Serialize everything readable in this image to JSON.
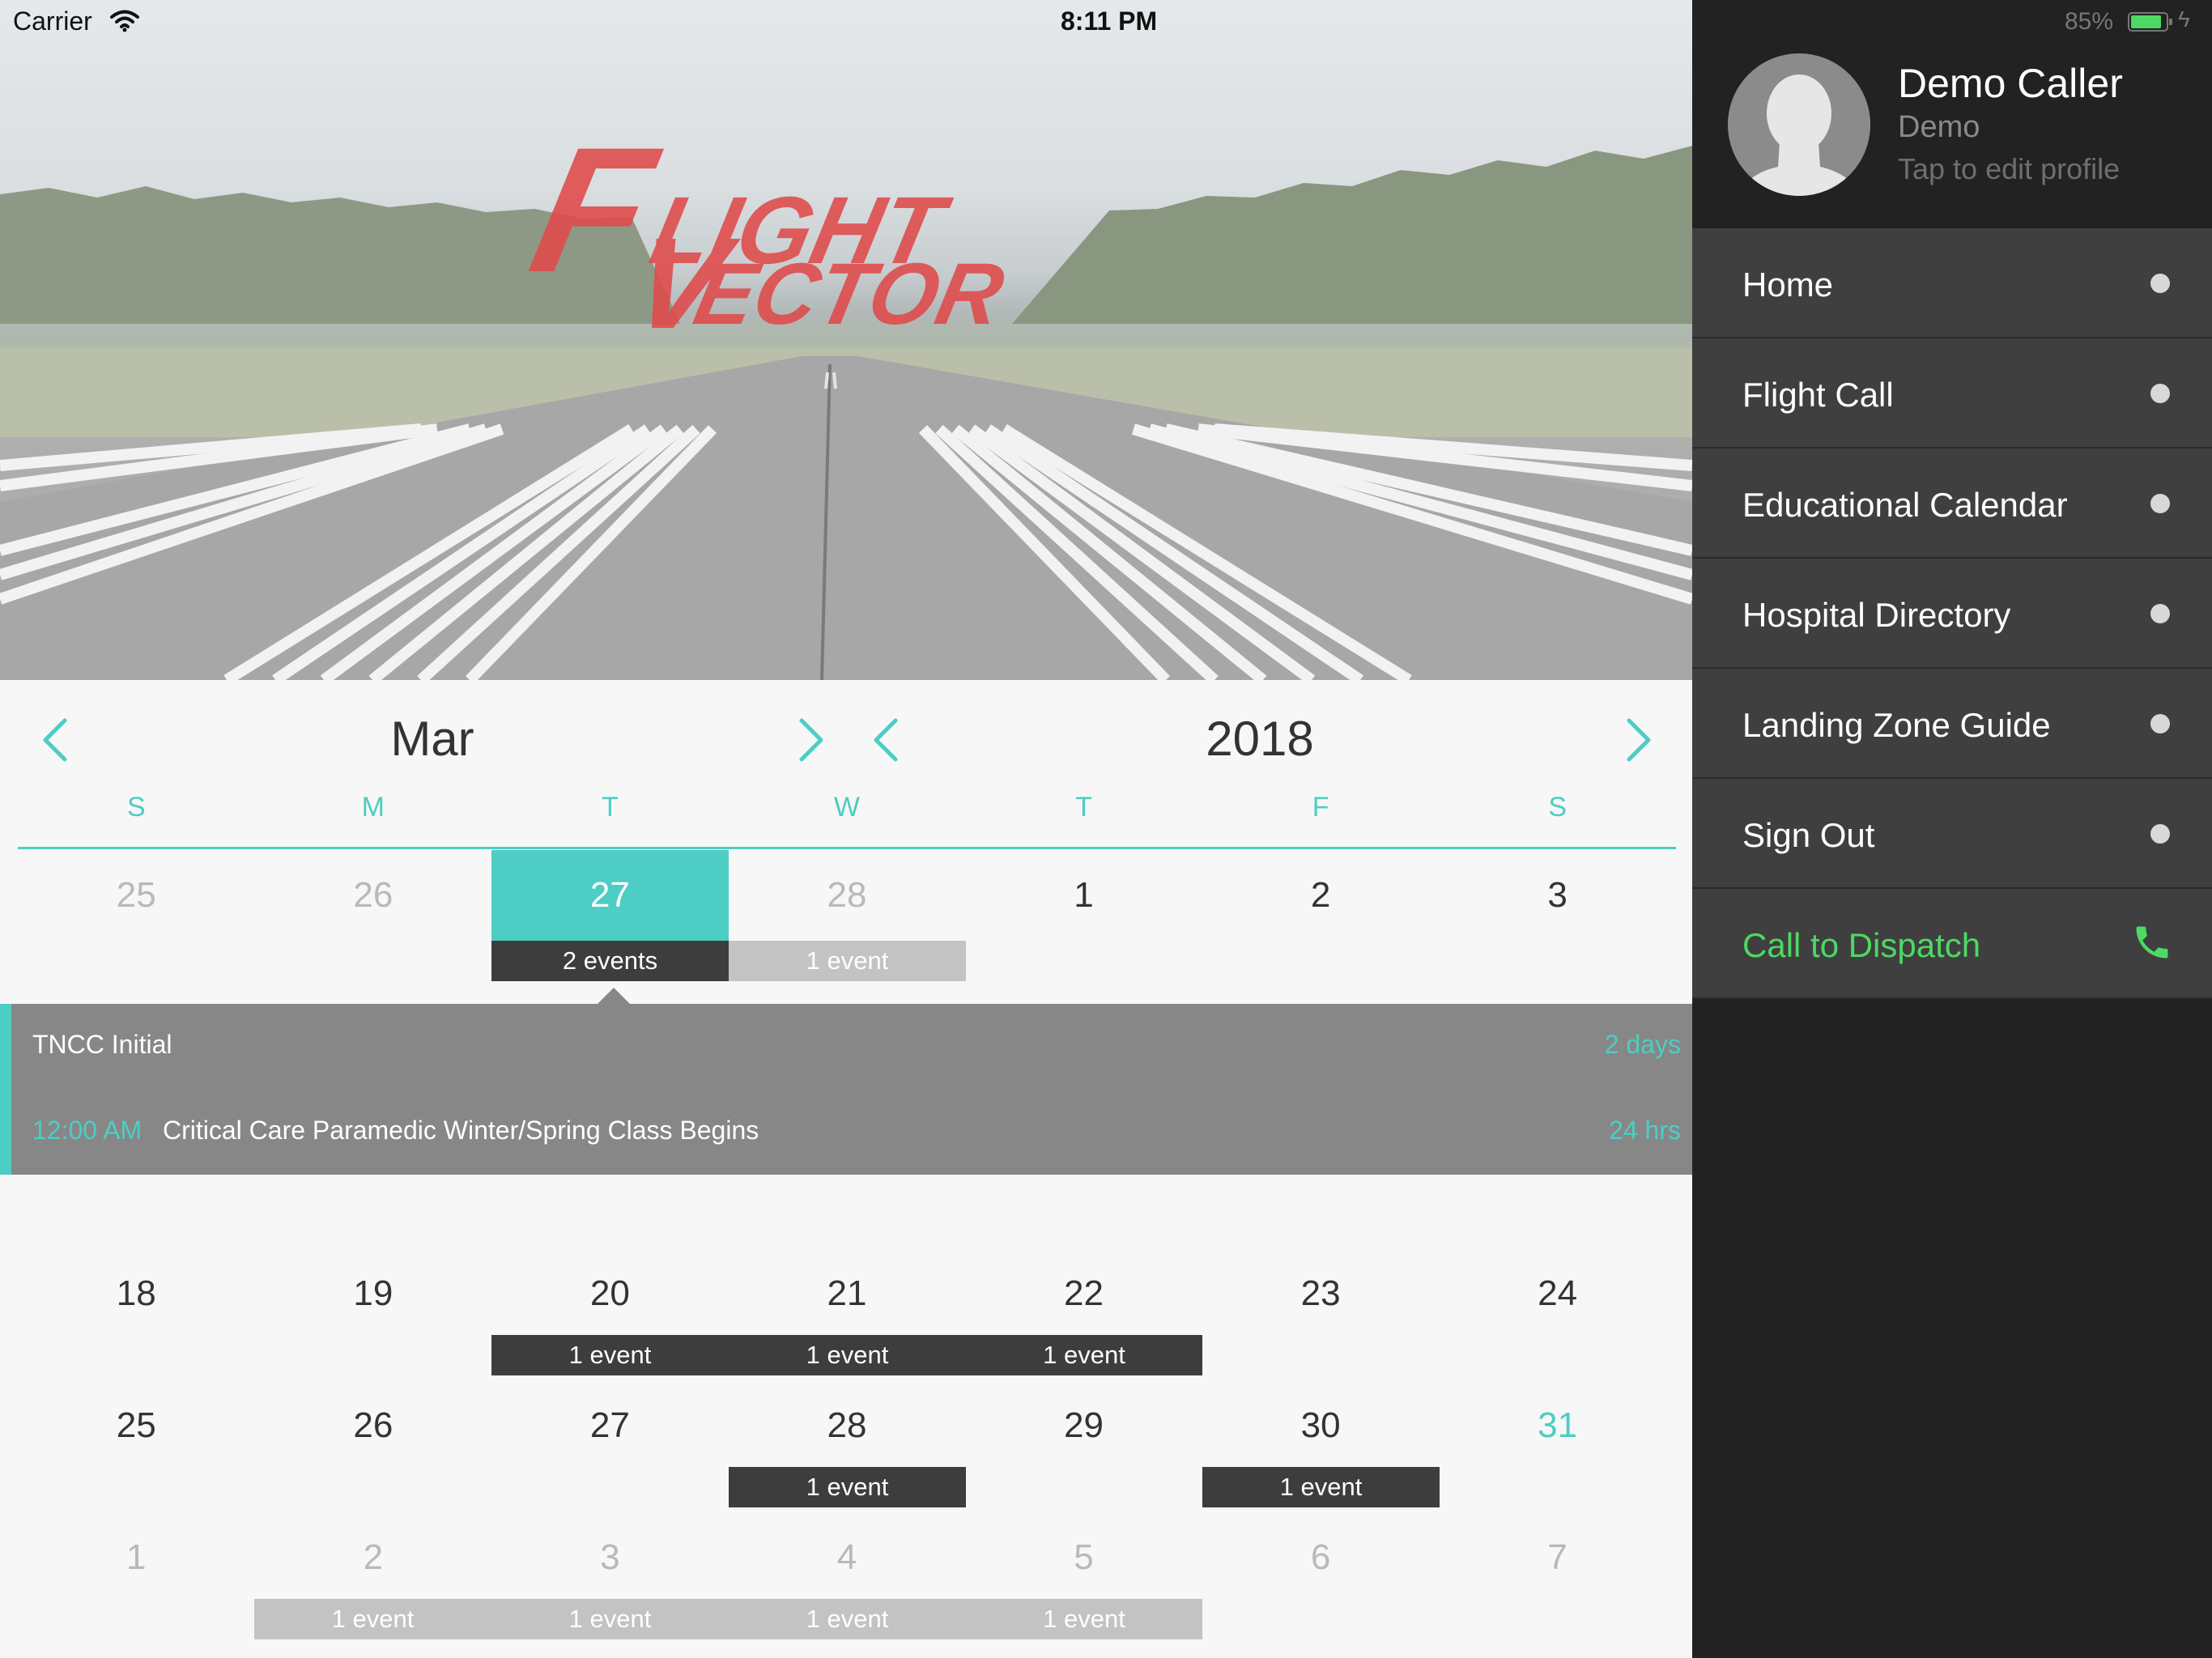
{
  "status_bar": {
    "carrier": "Carrier",
    "time": "8:11 PM",
    "battery_percent": "85%",
    "battery_level": 0.85
  },
  "hero": {
    "logo_text_line1": "LIGHT",
    "logo_text_line2": "ECTOR",
    "logo_initial1": "F",
    "logo_initial2": "V",
    "logo_color": "#e03a3a"
  },
  "calendar": {
    "month": "Mar",
    "year": "2018",
    "accent_color": "#4ecdc4",
    "weekdays": [
      "S",
      "M",
      "T",
      "W",
      "T",
      "F",
      "S"
    ],
    "week1": [
      "25",
      "26",
      "27",
      "28",
      "1",
      "2",
      "3"
    ],
    "week1_badges": {
      "selected": "2 events",
      "other": "1 event"
    },
    "events": [
      {
        "time": "",
        "title": "TNCC Initial",
        "duration": "2 days"
      },
      {
        "time": "12:00 AM",
        "title": "Critical Care Paramedic Winter/Spring Class Begins",
        "duration": "24 hrs"
      }
    ],
    "week2": [
      "18",
      "19",
      "20",
      "21",
      "22",
      "23",
      "24"
    ],
    "week2_badges": [
      "1 event",
      "1 event",
      "1 event"
    ],
    "week3": [
      "25",
      "26",
      "27",
      "28",
      "29",
      "30",
      "31"
    ],
    "week3_badges": [
      "1 event",
      "1 event"
    ],
    "week4": [
      "1",
      "2",
      "3",
      "4",
      "5",
      "6",
      "7"
    ],
    "week4_badges": [
      "1 event",
      "1 event",
      "1 event",
      "1 event"
    ]
  },
  "sidebar": {
    "profile": {
      "name": "Demo Caller",
      "role": "Demo",
      "hint": "Tap to edit profile"
    },
    "menu": [
      {
        "label": "Home"
      },
      {
        "label": "Flight Call"
      },
      {
        "label": "Educational Calendar"
      },
      {
        "label": "Hospital Directory"
      },
      {
        "label": "Landing Zone Guide"
      },
      {
        "label": "Sign Out"
      }
    ],
    "dispatch": {
      "label": "Call to Dispatch",
      "icon": "phone-icon",
      "color": "#4cd964"
    }
  }
}
